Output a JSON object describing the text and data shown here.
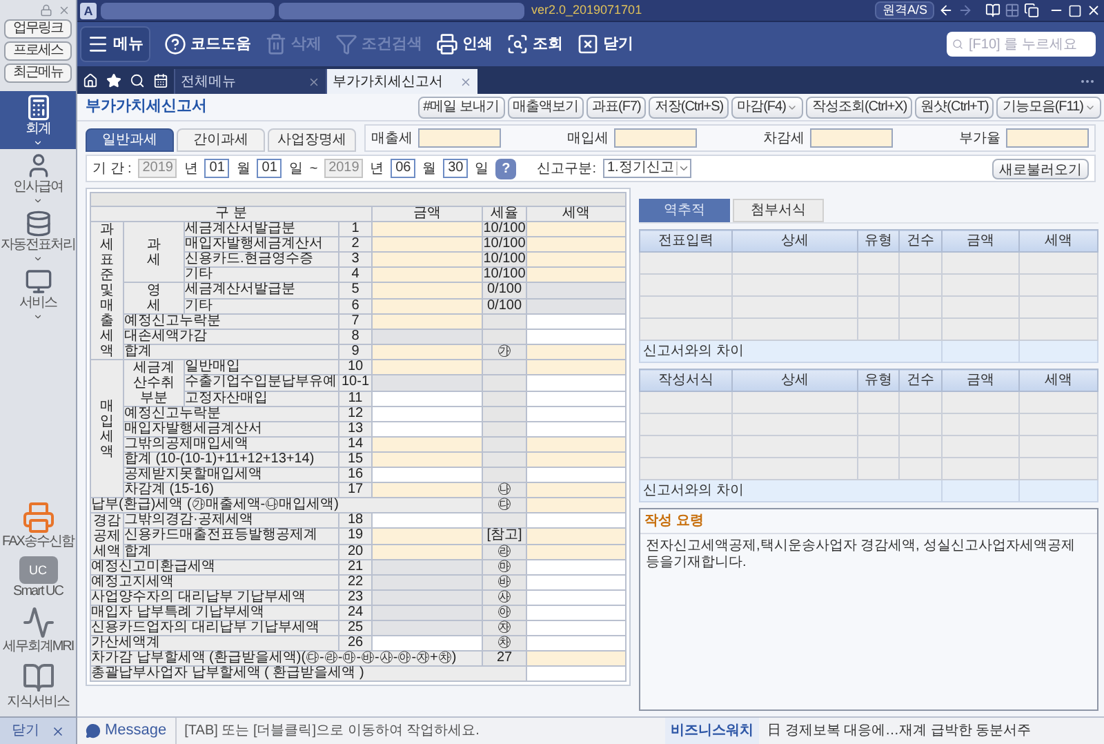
{
  "sidebar": {
    "quick_buttons": [
      "업무링크",
      "프로세스",
      "최근메뉴"
    ],
    "modules": [
      {
        "label": "회계",
        "kind": "calculator",
        "selected": true
      },
      {
        "label": "인사급여",
        "kind": "person",
        "selected": false
      },
      {
        "label": "자동전표처리",
        "kind": "database",
        "selected": false
      },
      {
        "label": "서비스",
        "kind": "monitor",
        "selected": false
      }
    ],
    "services": [
      {
        "label": "FAX송수신함",
        "kind": "fax"
      },
      {
        "label": "Smart UC",
        "kind": "uc",
        "badge": "UC"
      },
      {
        "label": "세무회계MRI",
        "kind": "pulse"
      },
      {
        "label": "지식서비스",
        "kind": "book"
      }
    ],
    "close": "닫기"
  },
  "titlebar": {
    "app_mark": "A",
    "version": "ver2.0_2019071701",
    "remote": "원격A/S"
  },
  "toolbar": {
    "items": [
      {
        "label": "메뉴",
        "kind": "menu",
        "disabled": false
      },
      {
        "label": "코드도움",
        "kind": "help",
        "disabled": false
      },
      {
        "label": "삭제",
        "kind": "trash",
        "disabled": true
      },
      {
        "label": "조건검색",
        "kind": "filter",
        "disabled": true
      },
      {
        "label": "인쇄",
        "kind": "print",
        "disabled": false
      },
      {
        "label": "조회",
        "kind": "lookup",
        "disabled": false
      },
      {
        "label": "닫기",
        "kind": "close",
        "disabled": false
      }
    ],
    "search_placeholder": "[F10] 를 누르세요"
  },
  "tabs": [
    {
      "label": "전체메뉴",
      "selected": false
    },
    {
      "label": "부가가치세신고서",
      "selected": true
    }
  ],
  "form": {
    "title": "부가가치세신고서",
    "actions": [
      {
        "label": "#메일 보내기",
        "menu": false
      },
      {
        "label": "매출액보기",
        "menu": false
      },
      {
        "label": "과표(F7)",
        "menu": false
      },
      {
        "label": "저장(Ctrl+S)",
        "menu": false
      },
      {
        "label": "마감(F4)",
        "menu": true
      },
      {
        "label": "작성조회(Ctrl+X)",
        "menu": false
      },
      {
        "label": "원샷(Ctrl+T)",
        "menu": false
      },
      {
        "label": "기능모음(F11)",
        "menu": true
      }
    ],
    "subtabs": [
      {
        "label": "일반과세",
        "selected": true
      },
      {
        "label": "간이과세",
        "selected": false
      },
      {
        "label": "사업장명세",
        "selected": false
      }
    ],
    "summary": [
      "매출세",
      "매입세",
      "차감세",
      "부가율"
    ],
    "period": [
      {
        "kind": "label",
        "text": "기 간 :"
      },
      {
        "kind": "fixed",
        "text": "2019"
      },
      {
        "kind": "label",
        "text": "년"
      },
      {
        "kind": "input",
        "text": "01"
      },
      {
        "kind": "label",
        "text": "월"
      },
      {
        "kind": "input",
        "text": "01"
      },
      {
        "kind": "label",
        "text": "일"
      },
      {
        "kind": "label",
        "text": "~"
      },
      {
        "kind": "fixed",
        "text": "2019"
      },
      {
        "kind": "label",
        "text": "년"
      },
      {
        "kind": "input",
        "text": "06"
      },
      {
        "kind": "label",
        "text": "월"
      },
      {
        "kind": "input",
        "text": "30"
      },
      {
        "kind": "label",
        "text": "일"
      },
      {
        "kind": "help",
        "text": "?"
      }
    ],
    "report_type": {
      "label": "신고구분:",
      "value": "1.정기신고"
    },
    "reload": "새로불러오기"
  },
  "table": {
    "columns": [
      "구 분",
      "금액",
      "세율",
      "세액"
    ],
    "sections": [
      {
        "kind": "group",
        "label": "과세표준및매출세액",
        "children": [
          {
            "kind": "subgroup",
            "label": "과세",
            "children": [
              {
                "label": "세금계산서발급분",
                "no": "1",
                "amount": {
                  "kind": "entry"
                },
                "rate": "10/100",
                "tax": {
                  "kind": "entry"
                }
              },
              {
                "label": "매입자발행세금계산서",
                "no": "2",
                "amount": {
                  "kind": "entry"
                },
                "rate": "10/100",
                "tax": {
                  "kind": "entry"
                }
              },
              {
                "label": "신용카드.현금영수증",
                "no": "3",
                "amount": {
                  "kind": "entry"
                },
                "rate": "10/100",
                "tax": {
                  "kind": "entry"
                }
              },
              {
                "label": "기타",
                "no": "4",
                "amount": {
                  "kind": "entry"
                },
                "rate": "10/100",
                "tax": {
                  "kind": "entry"
                }
              }
            ]
          },
          {
            "kind": "subgroup",
            "label": "영세",
            "children": [
              {
                "label": "세금계산서발급분",
                "no": "5",
                "amount": {
                  "kind": "entry"
                },
                "rate": "0/100",
                "tax": {
                  "kind": "shaded"
                }
              },
              {
                "label": "기타",
                "no": "6",
                "amount": {
                  "kind": "entry"
                },
                "rate": "0/100",
                "tax": {
                  "kind": "shaded"
                }
              }
            ]
          },
          {
            "kind": "line",
            "label": "예정신고누락분",
            "no": "7",
            "amount": {
              "kind": "entry"
            },
            "tax": {
              "kind": "open"
            }
          },
          {
            "kind": "line",
            "label": "대손세액가감",
            "no": "8",
            "amount": {
              "kind": "shaded"
            },
            "tax": {
              "kind": "open"
            }
          },
          {
            "kind": "line",
            "label": "합계",
            "no": "9",
            "amount": {
              "kind": "entry"
            },
            "rate": "㉮",
            "tax": {
              "kind": "entry"
            }
          }
        ]
      },
      {
        "kind": "group",
        "label": "매입세액",
        "children": [
          {
            "kind": "subgroup",
            "label": "세금계산수취부분",
            "children": [
              {
                "label": "일반매입",
                "no": "10",
                "amount": {
                  "kind": "entry"
                },
                "tax": {
                  "kind": "entry"
                }
              },
              {
                "label": "수출기업수입분납부유예",
                "no": "10-1",
                "amount": {
                  "kind": "shaded"
                },
                "tax": {
                  "kind": "open"
                }
              },
              {
                "label": "고정자산매입",
                "no": "11",
                "amount": {
                  "kind": "open"
                },
                "tax": {
                  "kind": "open"
                }
              }
            ]
          },
          {
            "kind": "line",
            "label": "예정신고누락분",
            "no": "12",
            "amount": {
              "kind": "open"
            },
            "tax": {
              "kind": "open"
            }
          },
          {
            "kind": "line",
            "label": "매입자발행세금계산서",
            "no": "13",
            "amount": {
              "kind": "open"
            },
            "tax": {
              "kind": "open"
            }
          },
          {
            "kind": "line",
            "label": "그밖의공제매입세액",
            "no": "14",
            "amount": {
              "kind": "entry"
            },
            "tax": {
              "kind": "entry"
            }
          },
          {
            "kind": "line",
            "label": "합계 (10-(10-1)+11+12+13+14)",
            "no": "15",
            "amount": {
              "kind": "entry"
            },
            "tax": {
              "kind": "entry"
            }
          },
          {
            "kind": "line",
            "label": "공제받지못할매입세액",
            "no": "16",
            "amount": {
              "kind": "open"
            },
            "tax": {
              "kind": "open"
            }
          },
          {
            "kind": "line",
            "label": "차감계 (15-16)",
            "no": "17",
            "amount": {
              "kind": "entry"
            },
            "rate": "㉯",
            "tax": {
              "kind": "entry"
            }
          }
        ]
      },
      {
        "kind": "wide",
        "label": "납부(환급)세액 (㉮매출세액-㉯매입세액)",
        "rate": "㉰",
        "tax": {
          "kind": "entry"
        }
      },
      {
        "kind": "group",
        "label": "경감공제세액",
        "children": [
          {
            "kind": "line",
            "label": "그밖의경감·공제세액",
            "no": "18",
            "amount": {
              "kind": "open"
            },
            "tax": {
              "kind": "open"
            }
          },
          {
            "kind": "line",
            "label": "신용카드매출전표등발행공제계",
            "no": "19",
            "amount": {
              "kind": "entry"
            },
            "rate": "[참고]",
            "tax": {
              "kind": "entry"
            }
          },
          {
            "kind": "line",
            "label": "합계",
            "no": "20",
            "amount": {
              "kind": "entry"
            },
            "rate": "㉱",
            "tax": {
              "kind": "entry"
            }
          }
        ]
      },
      {
        "kind": "line",
        "label": "예정신고미환급세액",
        "no": "21",
        "amount": {
          "kind": "shaded"
        },
        "rate": "㉲",
        "tax": {
          "kind": "open"
        }
      },
      {
        "kind": "line",
        "label": "예정고지세액",
        "no": "22",
        "amount": {
          "kind": "shaded"
        },
        "rate": "㉳",
        "tax": {
          "kind": "open"
        }
      },
      {
        "kind": "line",
        "label": "사업양수자의 대리납부 기납부세액",
        "no": "23",
        "amount": {
          "kind": "shaded"
        },
        "rate": "㉴",
        "tax": {
          "kind": "open"
        }
      },
      {
        "kind": "line",
        "label": "매입자 납부특례 기납부세액",
        "no": "24",
        "amount": {
          "kind": "shaded"
        },
        "rate": "㉵",
        "tax": {
          "kind": "open"
        }
      },
      {
        "kind": "line",
        "label": "신용카드업자의 대리납부 기납부세액",
        "no": "25",
        "amount": {
          "kind": "shaded"
        },
        "rate": "㉶",
        "tax": {
          "kind": "open"
        }
      },
      {
        "kind": "line",
        "label": "가산세액계",
        "no": "26",
        "amount": {
          "kind": "open"
        },
        "rate": "㉷",
        "tax": {
          "kind": "open"
        }
      },
      {
        "kind": "wide",
        "label": "차가감 납부할세액 (환급받을세액)(㉰-㉱-㉲-㉳-㉴-㉵-㉶+㉷)",
        "rate": "27",
        "tax": {
          "kind": "entry"
        }
      },
      {
        "kind": "final",
        "label": "총괄납부사업자 납부할세액 ( 환급받을세액 )",
        "tax": {
          "kind": "open"
        }
      }
    ]
  },
  "audit": {
    "tabs": [
      {
        "label": "역추적",
        "selected": true
      },
      {
        "label": "첨부서식",
        "selected": false
      }
    ],
    "grids": [
      {
        "columns": [
          "전표입력",
          "상세",
          "유형",
          "건수",
          "금액",
          "세액"
        ],
        "footer": "신고서와의 차이"
      },
      {
        "columns": [
          "작성서식",
          "상세",
          "유형",
          "건수",
          "금액",
          "세액"
        ],
        "footer": "신고서와의 차이"
      }
    ],
    "guide": {
      "title": "작성 요령",
      "text": "전자신고세액공제,택시운송사업자 경감세액, 성실신고사업자세액공제 등을기재합니다."
    }
  },
  "status": {
    "message_label": "Message",
    "message": "[TAB] 또는 [더블클릭]으로 이동하여 작업하세요.",
    "news_source": "비즈니스워치",
    "news": "日 경제보복 대응에…재계 급박한 동분서주"
  }
}
